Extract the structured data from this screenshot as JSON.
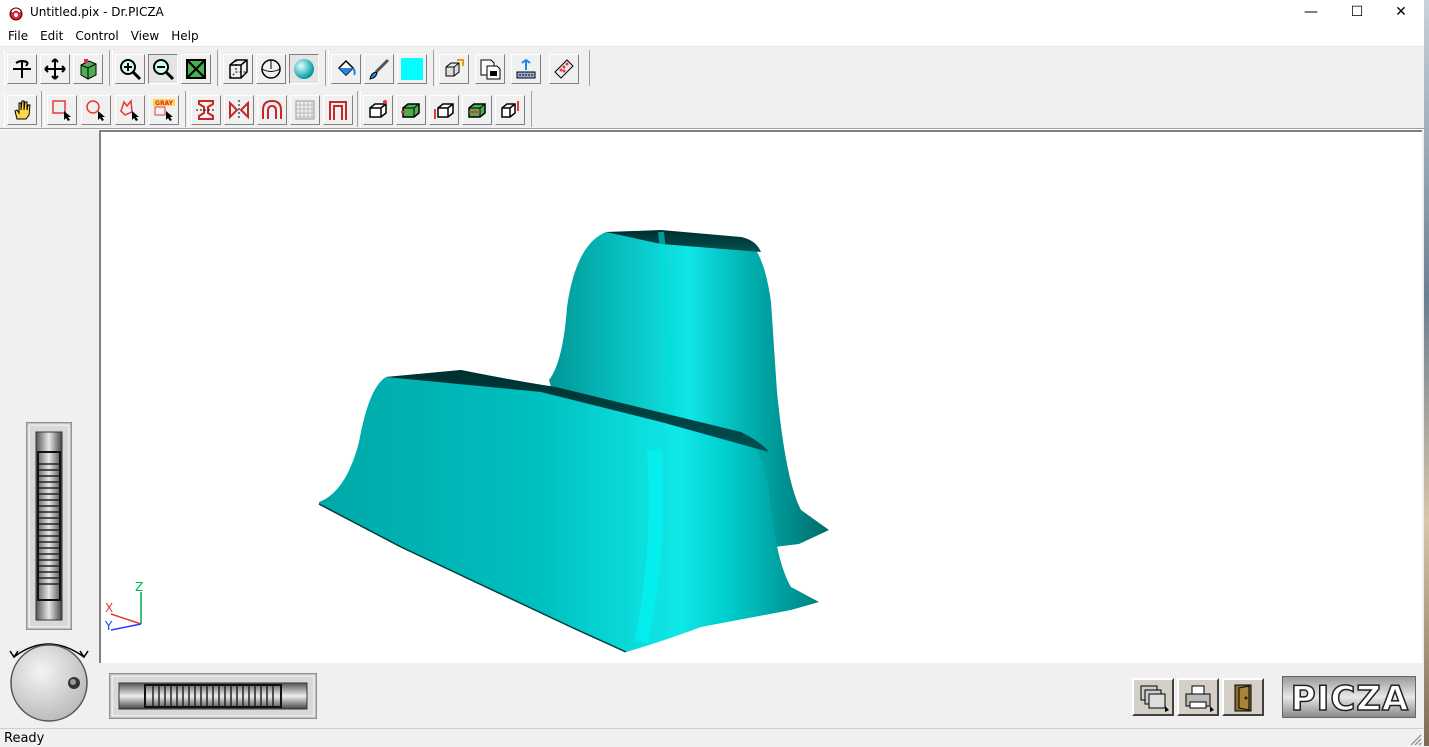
{
  "window": {
    "title": "Untitled.pix - Dr.PICZA",
    "minimize_glyph": "—",
    "maximize_glyph": "☐",
    "close_glyph": "✕"
  },
  "menu": {
    "items": [
      "File",
      "Edit",
      "Control",
      "View",
      "Help"
    ]
  },
  "toolbar1": {
    "buttons": [
      "rotate-tool",
      "pan-tool",
      "texture-box-tool",
      "zoom-in-tool",
      "zoom-out-tool",
      "zoom-fit-tool",
      "wireframe-view",
      "hidden-line-view",
      "shaded-view",
      "paint-bucket-tool",
      "brush-tool",
      "color-swatch",
      "multi-object-tool",
      "copy-document-tool",
      "scan-tool",
      "edit-points-tool"
    ],
    "pressed": [
      "zoom-out-tool",
      "shaded-view"
    ],
    "swatch_color": "#00ffff"
  },
  "toolbar2": {
    "buttons": [
      "hand-tool",
      "rectangle-select-tool",
      "ellipse-select-tool",
      "lasso-select-tool",
      "gray-select-tool",
      "cut-section-tool",
      "mirror-tool",
      "arch-tool",
      "grid-tool",
      "frame-tool",
      "box-tool-1",
      "box-tool-2",
      "box-tool-3",
      "box-tool-4",
      "box-tool-5"
    ]
  },
  "toolbar2_labels": {
    "gray_select_badge": "GRAY"
  },
  "axes": {
    "x": "X",
    "y": "Y",
    "z": "Z"
  },
  "viewport": {
    "model_color": "#00c8c8",
    "background": "#ffffff"
  },
  "bottom": {
    "logo": "PICZA"
  },
  "status": {
    "text": "Ready"
  }
}
